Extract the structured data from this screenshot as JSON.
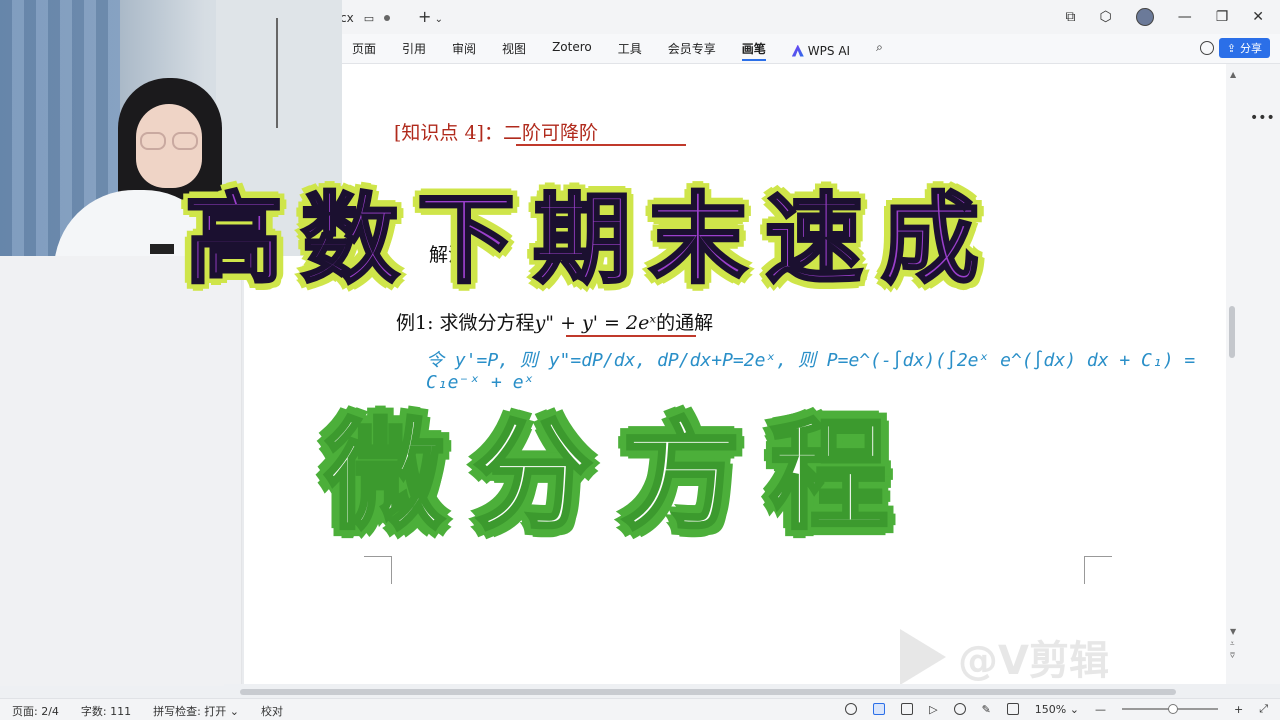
{
  "titlebar": {
    "tab_fragment": "cx",
    "new_tab": "+"
  },
  "menu": {
    "items": [
      "页面",
      "引用",
      "审阅",
      "视图",
      "Zotero",
      "工具",
      "会员专享",
      "画笔",
      "WPS AI"
    ],
    "active_index": 7,
    "share_label": "分享"
  },
  "document": {
    "heading_prefix": "[知识点 4]：",
    "heading_topic": "二阶可降阶",
    "method_label": "解法",
    "example_label": "例1:",
    "example_text": "求微分方程",
    "example_equation": "y\" + y' = 2eˣ",
    "example_suffix": "的通解",
    "handwritten_line": "令 y'=P, 则 y\"=dP/dx,  dP/dx+P=2eˣ,  则 P=e^(-∫dx)(∫2eˣ e^(∫dx) dx + C₁) = C₁e⁻ˣ + eˣ"
  },
  "overlay": {
    "title_top": "高数下期末速成",
    "title_bottom": "微分方程"
  },
  "watermark": {
    "text": "@V剪辑"
  },
  "status": {
    "page": "页面: 2/4",
    "words": "字数: 111",
    "spellcheck": "拼写检查: 打开",
    "proof": "校对",
    "zoom": "150%"
  },
  "colors": {
    "accent": "#2b6fe8",
    "heading_red": "#b02a1c",
    "handwriting_blue": "#2a8fc8",
    "overlay_purple": "#9b3fcc",
    "overlay_yellow": "#cfe54a",
    "overlay_green": "#4caf3a"
  }
}
